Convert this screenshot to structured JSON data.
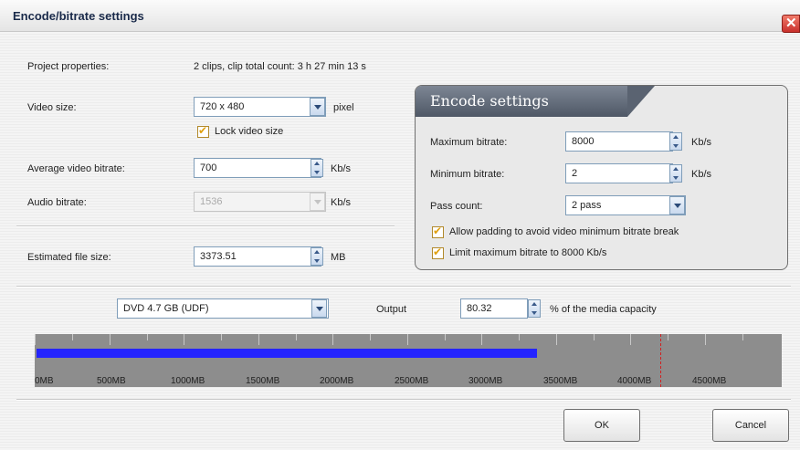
{
  "window": {
    "title": "Encode/bitrate settings",
    "close_symbol": "✕"
  },
  "project": {
    "label": "Project properties:",
    "value": "2 clips,  clip total count: 3 h 27 min 13 s"
  },
  "video_size": {
    "label": "Video size:",
    "value": "720 x 480",
    "unit": "pixel"
  },
  "lock_video_size": {
    "label": "Lock video size",
    "checked": true
  },
  "avg_bitrate": {
    "label": "Average video bitrate:",
    "value": "700",
    "unit": "Kb/s"
  },
  "audio_bitrate": {
    "label": "Audio bitrate:",
    "value": "1536",
    "unit": "Kb/s"
  },
  "file_size": {
    "label": "Estimated file size:",
    "value": "3373.51",
    "unit": "MB"
  },
  "encode": {
    "title": "Encode settings",
    "max_bitrate": {
      "label": "Maximum bitrate:",
      "value": "8000",
      "unit": "Kb/s"
    },
    "min_bitrate": {
      "label": "Minimum bitrate:",
      "value": "2",
      "unit": "Kb/s"
    },
    "pass_count": {
      "label": "Pass count:",
      "value": "2 pass"
    },
    "allow_padding": {
      "label": "Allow padding to avoid video minimum bitrate break",
      "checked": true
    },
    "limit_max": {
      "label": "Limit maximum bitrate to 8000 Kb/s",
      "checked": true
    }
  },
  "media": {
    "value": "DVD 4.7 GB (UDF)",
    "output_label": "Output",
    "output_value": "80.32",
    "output_suffix": "% of the media capacity"
  },
  "capacity_meter": {
    "fill_fraction": 0.67,
    "axis": [
      "0MB",
      "500MB",
      "1000MB",
      "1500MB",
      "2000MB",
      "2500MB",
      "3000MB",
      "3500MB",
      "4000MB",
      "4500MB"
    ]
  },
  "buttons": {
    "ok": "OK",
    "cancel": "Cancel"
  },
  "colors": {
    "bar": "#2424ff",
    "limit_marker": "#d02020",
    "check": "#e0a010"
  }
}
